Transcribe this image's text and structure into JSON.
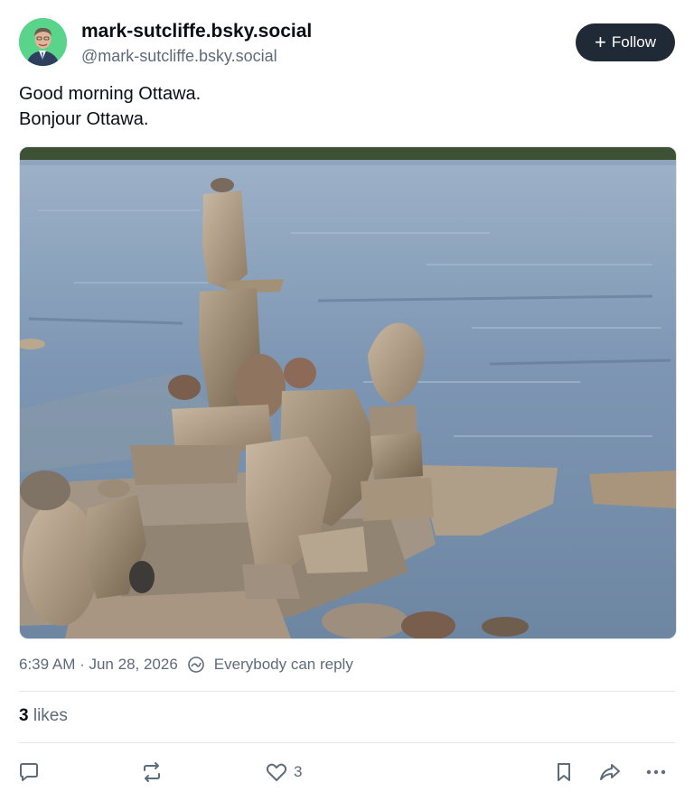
{
  "author": {
    "display_name": "mark-sutcliffe.bsky.social",
    "handle": "@mark-sutcliffe.bsky.social",
    "avatar_bg": "#5ad48a"
  },
  "follow_button": {
    "label": "Follow",
    "icon": "plus-icon"
  },
  "post": {
    "lines": [
      "Good morning Ottawa.",
      "Bonjour Ottawa."
    ]
  },
  "image": {
    "subject": "balanced-stone-sculptures-on-river"
  },
  "meta": {
    "timestamp": "6:39 AM · Jun 28, 2026",
    "reply_setting": "Everybody can reply"
  },
  "likes": {
    "count": "3",
    "label": "likes"
  },
  "actions": {
    "reply_icon": "comment-icon",
    "repost_icon": "repost-icon",
    "like_icon": "heart-icon",
    "like_count": "3",
    "bookmark_icon": "bookmark-icon",
    "share_icon": "share-icon",
    "more_icon": "more-icon"
  },
  "colors": {
    "button_bg": "#1f2a36",
    "muted_text": "#5e6b7a",
    "divider": "#e3e7eb"
  }
}
